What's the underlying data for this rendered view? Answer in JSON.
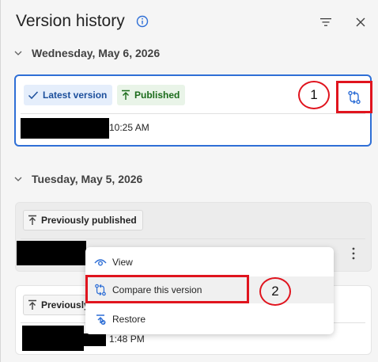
{
  "header": {
    "title": "Version history"
  },
  "icons": {
    "info": "info-icon",
    "filter": "filter-icon",
    "close": "close-icon",
    "compare": "compare-icon",
    "view": "eye-icon",
    "restore": "restore-icon",
    "more": "more-vertical-icon"
  },
  "groups": [
    {
      "date": "Wednesday, May 6, 2026"
    },
    {
      "date": "Tuesday, May 5, 2026"
    }
  ],
  "versions": [
    {
      "badges": [
        "Latest version",
        "Published"
      ],
      "time": "10:25 AM"
    },
    {
      "badges": [
        "Previously published"
      ],
      "time": ""
    },
    {
      "badges": [
        "Previously"
      ],
      "time": "1:48 PM"
    }
  ],
  "menu": {
    "items": [
      "View",
      "Compare this version",
      "Restore"
    ]
  },
  "callouts": [
    "1",
    "2"
  ],
  "colors": {
    "accent": "#2f6fd6",
    "annotation_red": "#e0141e",
    "published_green": "#1a6b1a"
  }
}
